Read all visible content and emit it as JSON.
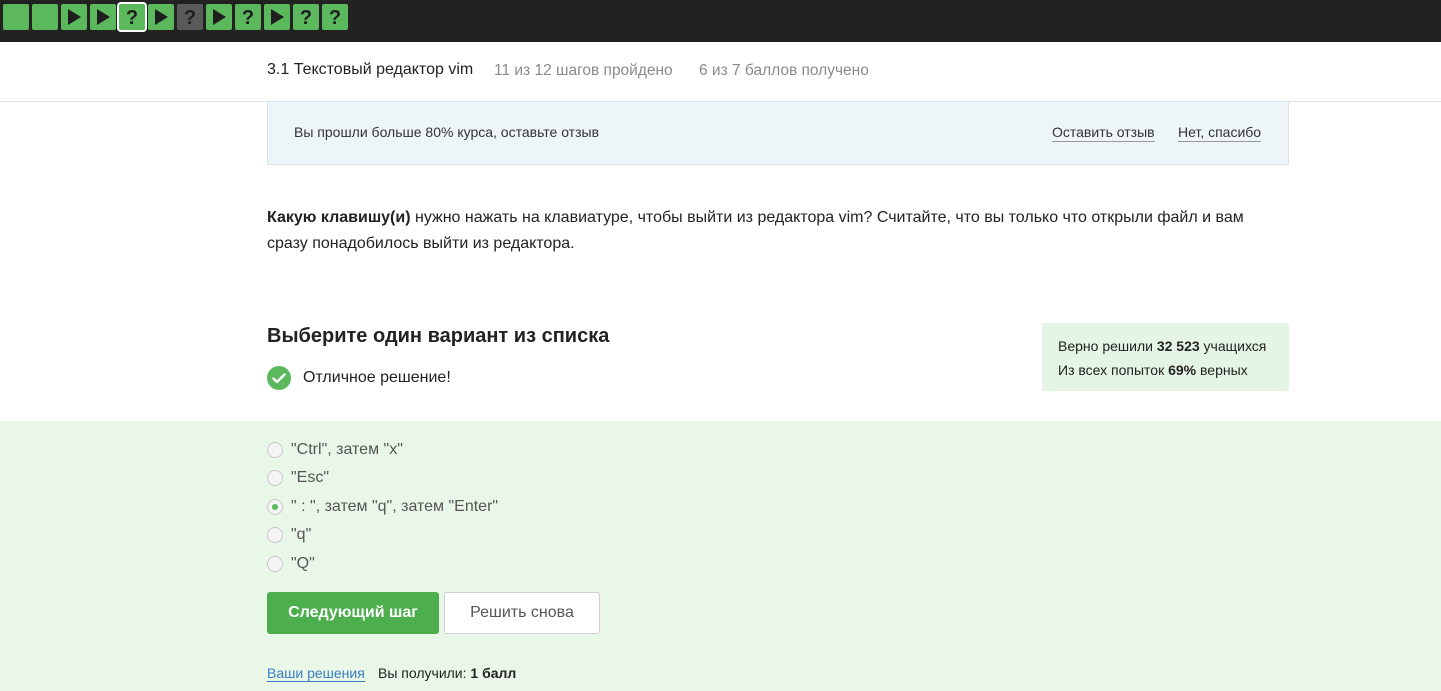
{
  "steps": [
    {
      "kind": "text",
      "status": "done"
    },
    {
      "kind": "text",
      "status": "done"
    },
    {
      "kind": "video",
      "status": "done"
    },
    {
      "kind": "video",
      "status": "done"
    },
    {
      "kind": "quiz",
      "status": "done",
      "active": true
    },
    {
      "kind": "video",
      "status": "done"
    },
    {
      "kind": "quiz",
      "status": "locked"
    },
    {
      "kind": "video",
      "status": "done"
    },
    {
      "kind": "quiz",
      "status": "done"
    },
    {
      "kind": "video",
      "status": "done"
    },
    {
      "kind": "quiz",
      "status": "done"
    },
    {
      "kind": "quiz",
      "status": "done"
    }
  ],
  "header": {
    "title": "3.1 Текстовый редактор vim",
    "steps_progress": "11 из 12 шагов пройдено",
    "score_progress": "6 из 7 баллов  получено"
  },
  "banner": {
    "text": "Вы прошли больше 80% курса, оставьте отзыв",
    "leave_review": "Оставить отзыв",
    "no_thanks": "Нет, спасибо"
  },
  "question": {
    "bold_part": "Какую клавишу(и)",
    "rest": " нужно нажать на клавиатуре, чтобы выйти из редактора vim? Считайте, что вы только что открыли файл и вам сразу понадобилось выйти из редактора."
  },
  "choose_title": "Выберите один вариант из списка",
  "result_text": "Отличное решение!",
  "stats": {
    "solved_prefix": "Верно решили ",
    "solved_count": "32 523",
    "solved_suffix": " учащихся",
    "attempts_prefix": "Из всех попыток ",
    "attempts_pct": "69%",
    "attempts_suffix": " верных"
  },
  "options": [
    {
      "label": "\"Ctrl\", затем \"x\"",
      "checked": false
    },
    {
      "label": "\"Esc\"",
      "checked": false
    },
    {
      "label": "\" : \", затем \"q\", затем \"Enter\"",
      "checked": true
    },
    {
      "label": "\"q\"",
      "checked": false
    },
    {
      "label": "\"Q\"",
      "checked": false
    }
  ],
  "buttons": {
    "next": "Следующий шаг",
    "retry": "Решить снова"
  },
  "footer": {
    "your_solutions": "Ваши решения",
    "you_got_prefix": "Вы получили: ",
    "you_got_value": "1 балл"
  },
  "colors": {
    "done": "#5cb85c",
    "locked": "#5a5a5a",
    "topbar": "#222222",
    "answers_bg": "#e8f7e8",
    "stats_bg": "#e5f5e5",
    "link": "#3b7dc4"
  }
}
